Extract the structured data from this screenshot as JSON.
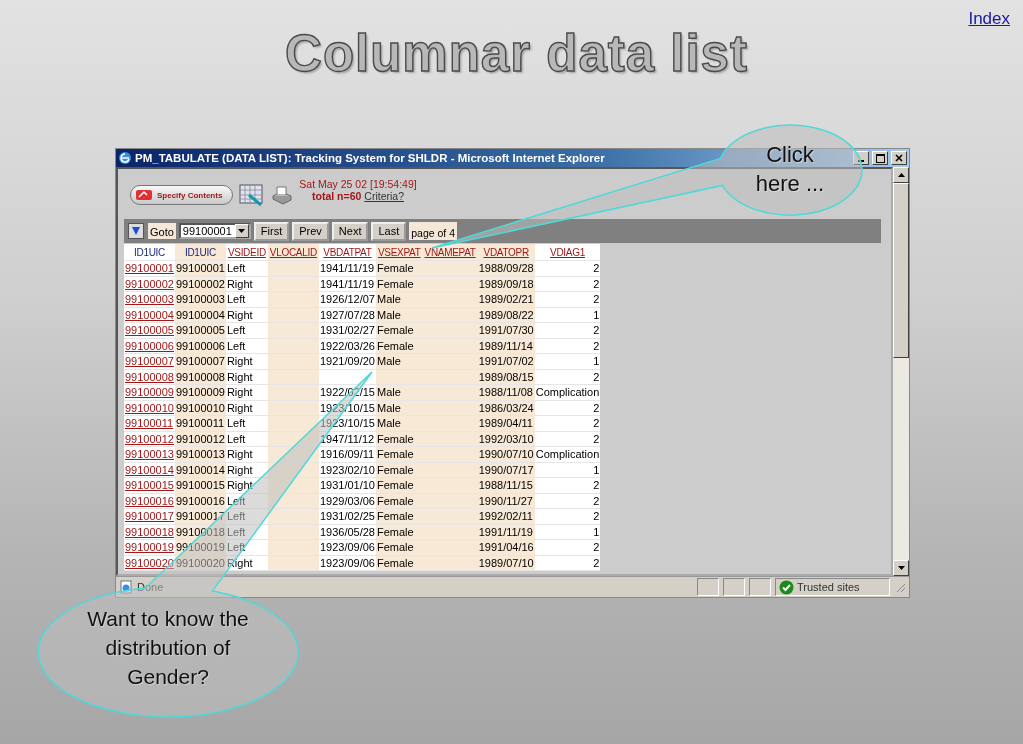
{
  "slide": {
    "title": "Columnar data list",
    "index_link": "Index"
  },
  "window": {
    "title": "PM_TABULATE (DATA LIST): Tracking System for SHLDR - Microsoft Internet Explorer"
  },
  "header": {
    "specify_button": "Specify Contents",
    "timestamp": "Sat May 25 02 [19:54:49]",
    "total": "total n=60",
    "criteria_link": "Criteria?"
  },
  "nav": {
    "goto_label": "Goto",
    "goto_value": "99100001",
    "buttons": [
      "First",
      "Prev",
      "Next",
      "Last"
    ],
    "page_text": "page of 4"
  },
  "table": {
    "columns": [
      {
        "label": "ID1UIC",
        "kind": "plain",
        "shaded": false
      },
      {
        "label": "ID1UIC",
        "kind": "plain",
        "shaded": true
      },
      {
        "label": "VSIDEID",
        "kind": "link",
        "shaded": false
      },
      {
        "label": "VLOCALID",
        "kind": "link",
        "shaded": true
      },
      {
        "label": "VBDATPAT",
        "kind": "link",
        "shaded": false
      },
      {
        "label": "VSEXPAT",
        "kind": "link",
        "shaded": true
      },
      {
        "label": "VNAMEPAT",
        "kind": "link",
        "shaded": true
      },
      {
        "label": "VDATOPR",
        "kind": "link",
        "shaded": true
      },
      {
        "label": "VDIAG1",
        "kind": "link",
        "shaded": false
      }
    ],
    "rows": [
      {
        "cells": [
          "99100001",
          "99100001",
          "Left",
          null,
          "1941/11/19",
          "Female",
          null,
          "1988/09/28",
          "2"
        ]
      },
      {
        "cells": [
          "99100002",
          "99100002",
          "Right",
          null,
          "1941/11/19",
          "Female",
          null,
          "1989/09/18",
          "2"
        ]
      },
      {
        "cells": [
          "99100003",
          "99100003",
          "Left",
          null,
          "1926/12/07",
          "Male",
          null,
          "1989/02/21",
          "2"
        ]
      },
      {
        "cells": [
          "99100004",
          "99100004",
          "Right",
          null,
          "1927/07/28",
          "Male",
          null,
          "1989/08/22",
          "1"
        ]
      },
      {
        "cells": [
          "99100005",
          "99100005",
          "Left",
          null,
          "1931/02/27",
          "Female",
          null,
          "1991/07/30",
          "2"
        ]
      },
      {
        "cells": [
          "99100006",
          "99100006",
          "Left",
          null,
          "1922/03/26",
          "Female",
          null,
          "1989/11/14",
          "2"
        ]
      },
      {
        "cells": [
          "99100007",
          "99100007",
          "Right",
          null,
          "1921/09/20",
          "Male",
          null,
          "1991/07/02",
          "1"
        ]
      },
      {
        "cells": [
          "99100008",
          "99100008",
          "Right",
          null,
          null,
          null,
          null,
          "1989/08/15",
          "2"
        ]
      },
      {
        "cells": [
          "99100009",
          "99100009",
          "Right",
          null,
          "1922/02/15",
          "Male",
          null,
          "1988/11/08",
          "Complication"
        ]
      },
      {
        "cells": [
          "99100010",
          "99100010",
          "Right",
          null,
          "1923/10/15",
          "Male",
          null,
          "1986/03/24",
          "2"
        ]
      },
      {
        "cells": [
          "99100011",
          "99100011",
          "Left",
          null,
          "1923/10/15",
          "Male",
          null,
          "1989/04/11",
          "2"
        ]
      },
      {
        "cells": [
          "99100012",
          "99100012",
          "Left",
          null,
          "1947/11/12",
          "Female",
          null,
          "1992/03/10",
          "2"
        ]
      },
      {
        "cells": [
          "99100013",
          "99100013",
          "Right",
          null,
          "1916/09/11",
          "Female",
          null,
          "1990/07/10",
          "Complication"
        ]
      },
      {
        "cells": [
          "99100014",
          "99100014",
          "Right",
          null,
          "1923/02/10",
          "Female",
          null,
          "1990/07/17",
          "1"
        ]
      },
      {
        "cells": [
          "99100015",
          "99100015",
          "Right",
          null,
          "1931/01/10",
          "Female",
          null,
          "1988/11/15",
          "2"
        ]
      },
      {
        "cells": [
          "99100016",
          "99100016",
          "Left",
          null,
          "1929/03/06",
          "Female",
          null,
          "1990/11/27",
          "2"
        ]
      },
      {
        "cells": [
          "99100017",
          "99100017",
          "Left",
          null,
          "1931/02/25",
          "Female",
          null,
          "1992/02/11",
          "2"
        ]
      },
      {
        "cells": [
          "99100018",
          "99100018",
          "Left",
          null,
          "1936/05/28",
          "Female",
          null,
          "1991/11/19",
          "1"
        ]
      },
      {
        "cells": [
          "99100019",
          "99100019",
          "Left",
          null,
          "1923/09/06",
          "Female",
          null,
          "1991/04/16",
          "2"
        ]
      },
      {
        "cells": [
          "99100020",
          "99100020",
          "Right",
          null,
          "1923/09/06",
          "Female",
          null,
          "1989/07/10",
          "2"
        ]
      }
    ]
  },
  "status_bar": {
    "text": "Done",
    "zone": "Trusted sites"
  },
  "callouts": [
    {
      "text": "Click here ..."
    },
    {
      "text": "Want to know the distribution of Gender?"
    }
  ]
}
